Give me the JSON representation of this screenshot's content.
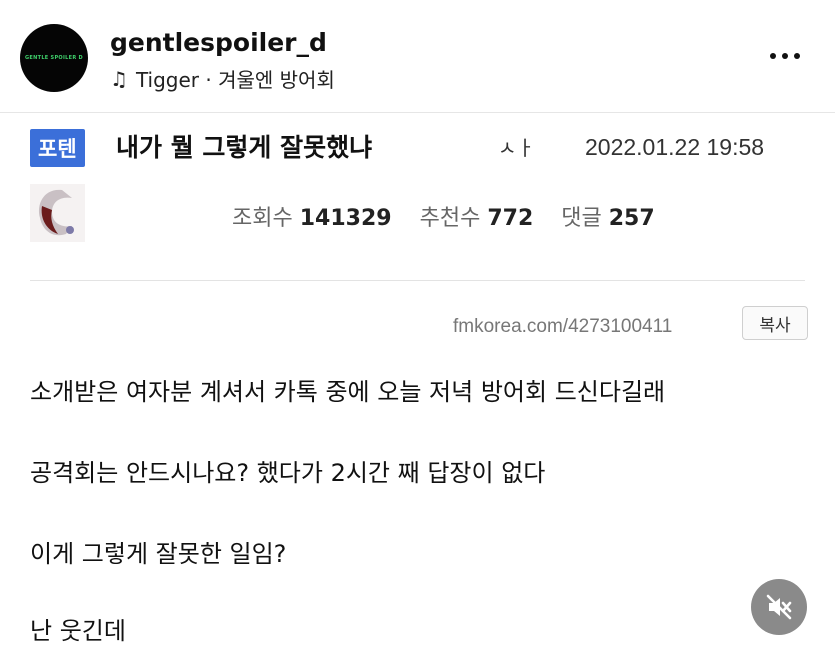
{
  "header": {
    "avatar_text": "GENTLE SPOILER D",
    "username": "gentlespoiler_d",
    "audio": "Tigger · 겨울엔 방어회"
  },
  "post": {
    "tag": "포텐",
    "title": "내가 뭘 그렇게 잘못했냐",
    "title_icon": "ㅅㅏ",
    "date": "2022.01.22 19:58",
    "stats": {
      "views_label": "조회수",
      "views": "141329",
      "likes_label": "추천수",
      "likes": "772",
      "comments_label": "댓글",
      "comments": "257"
    },
    "source_url": "fmkorea.com/4273100411",
    "copy_label": "복사",
    "lines": [
      "소개받은 여자분 계셔서 카톡 중에 오늘 저녁 방어회 드신다길래",
      "공격회는 안드시나요? 했다가 2시간 째 답장이 없다",
      "이게 그렇게 잘못한 일임?",
      "난 웃긴데"
    ]
  },
  "colors": {
    "tag_bg": "#3b6fd9",
    "mute_bg": "#8a8a8a"
  },
  "icons": {
    "audio": "music-note-icon",
    "more": "more-dots-icon",
    "mute": "speaker-muted-icon"
  }
}
